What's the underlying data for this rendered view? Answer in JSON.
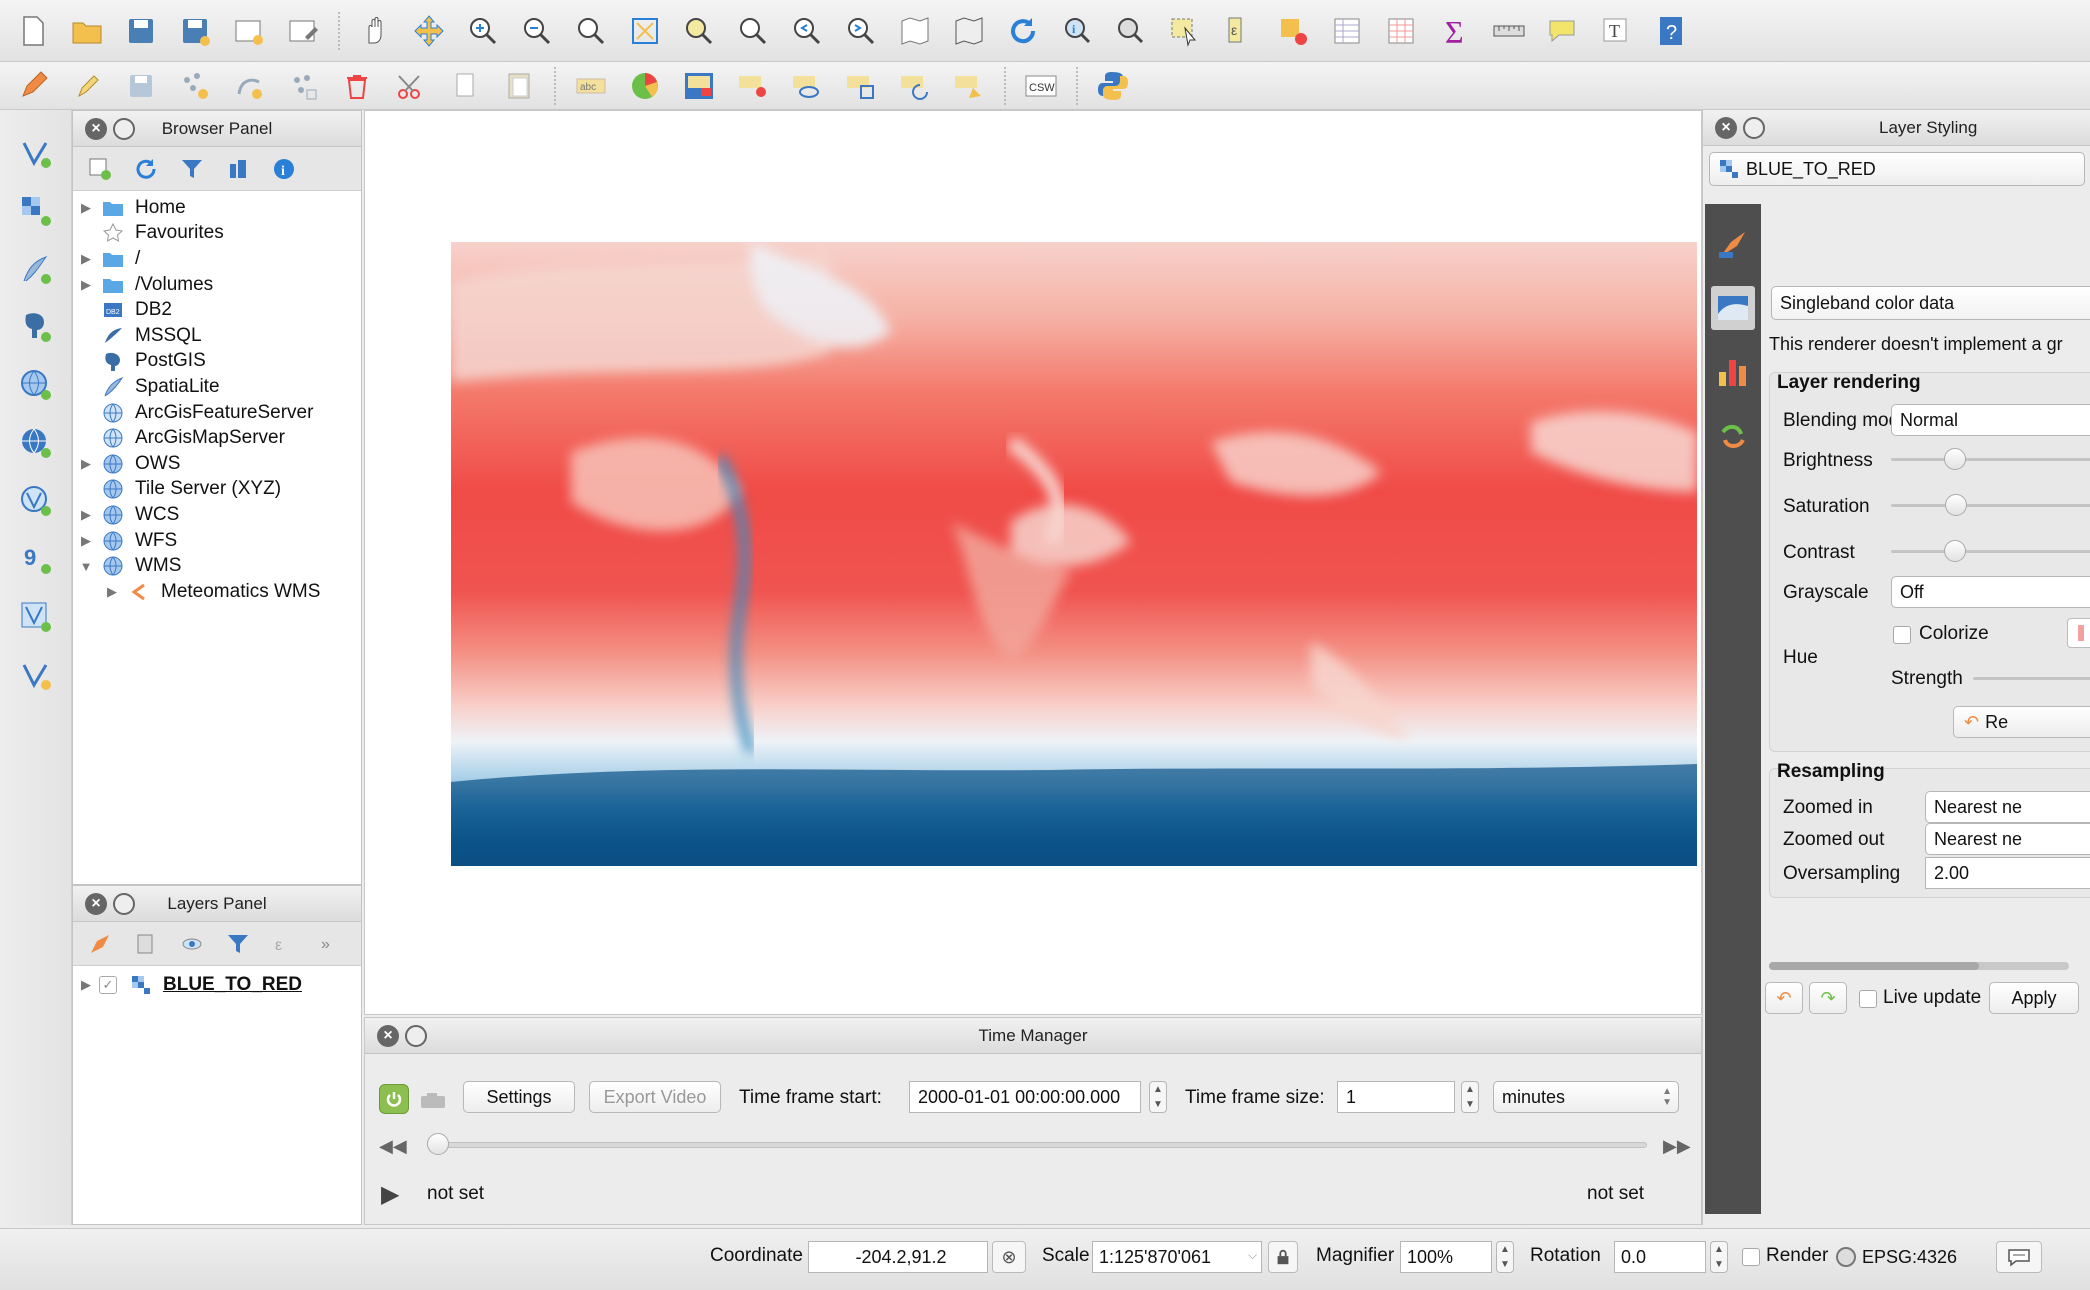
{
  "toolbar_top": {
    "icons": [
      "new-project-icon",
      "open-project-icon",
      "save-project-icon",
      "save-as-icon",
      "new-print-layout-icon",
      "layout-manager-icon",
      "pan-icon",
      "pan-to-selection-icon",
      "zoom-in-icon",
      "zoom-out-icon",
      "zoom-native-icon",
      "zoom-full-icon",
      "zoom-to-selection-icon",
      "zoom-to-layer-icon",
      "zoom-last-icon",
      "zoom-next-icon",
      "new-map-view-icon",
      "new-3d-map-icon",
      "refresh-icon",
      "identify-icon",
      "action-icon",
      "select-icon",
      "deselect-icon",
      "field-calculator-icon",
      "attribute-table-icon",
      "statistics-icon",
      "sum-icon",
      "measure-icon",
      "annotation-icon",
      "text-annotation-icon",
      "help-icon"
    ]
  },
  "toolbar_second": {
    "icons": [
      "edit-pencil-icon",
      "toggle-editing-icon",
      "save-edits-icon",
      "add-feature-icon",
      "node-tool-icon",
      "move-feature-icon",
      "delete-selected-icon",
      "cut-icon",
      "copy-icon",
      "paste-icon",
      "label-icon",
      "pie-diagram-icon",
      "label-highlight-icon",
      "pin-label-icon",
      "show-label-icon",
      "move-label-icon",
      "rotate-label-icon",
      "change-label-icon",
      "csw-icon",
      "python-icon"
    ],
    "csw_label": "CSW"
  },
  "left_toolbar": {
    "icons": [
      "add-vector-layer-icon",
      "add-raster-layer-icon",
      "add-spatialite-icon",
      "add-postgis-icon",
      "add-wms-icon",
      "add-wcs-icon",
      "add-wfs-icon",
      "add-delimited-text-icon",
      "add-virtual-layer-icon",
      "new-shapefile-icon"
    ]
  },
  "browser_panel": {
    "title": "Browser Panel",
    "items": [
      {
        "label": "Home",
        "icon": "folder-icon",
        "expandable": true
      },
      {
        "label": "Favourites",
        "icon": "star-icon",
        "expandable": false
      },
      {
        "label": "/",
        "icon": "folder-icon",
        "expandable": true
      },
      {
        "label": "/Volumes",
        "icon": "folder-icon",
        "expandable": true
      },
      {
        "label": "DB2",
        "icon": "db2-icon",
        "expandable": false
      },
      {
        "label": "MSSQL",
        "icon": "mssql-icon",
        "expandable": false
      },
      {
        "label": "PostGIS",
        "icon": "postgis-icon",
        "expandable": false
      },
      {
        "label": "SpatiaLite",
        "icon": "spatialite-icon",
        "expandable": false
      },
      {
        "label": "ArcGisFeatureServer",
        "icon": "arcgis-icon",
        "expandable": false
      },
      {
        "label": "ArcGisMapServer",
        "icon": "arcgis-icon",
        "expandable": false
      },
      {
        "label": "OWS",
        "icon": "globe-icon",
        "expandable": true
      },
      {
        "label": "Tile Server (XYZ)",
        "icon": "globe-icon",
        "expandable": false
      },
      {
        "label": "WCS",
        "icon": "globe-icon",
        "expandable": true
      },
      {
        "label": "WFS",
        "icon": "globe-icon",
        "expandable": true
      },
      {
        "label": "WMS",
        "icon": "globe-icon",
        "expandable": true,
        "expanded": true
      },
      {
        "label": "Meteomatics WMS",
        "icon": "connection-icon",
        "expandable": true,
        "child": true
      }
    ]
  },
  "layers_panel": {
    "title": "Layers Panel",
    "layer": {
      "name": "BLUE_TO_RED",
      "checked": true
    }
  },
  "time_manager": {
    "title": "Time Manager",
    "settings_label": "Settings",
    "export_label": "Export Video",
    "start_label": "Time frame start:",
    "start_value": "2000-01-01 00:00:00.000",
    "size_label": "Time frame size:",
    "size_value": "1",
    "unit_value": "minutes",
    "left_status": "not set",
    "right_status": "not set"
  },
  "layer_styling": {
    "title": "Layer Styling",
    "layer_select": "BLUE_TO_RED",
    "renderer": "Singleband color data",
    "renderer_note": "This renderer doesn't implement a gr",
    "layer_rendering_header": "Layer rendering",
    "blending_label": "Blending mode",
    "blending_value": "Normal",
    "brightness_label": "Brightness",
    "saturation_label": "Saturation",
    "contrast_label": "Contrast",
    "grayscale_label": "Grayscale",
    "grayscale_value": "Off",
    "hue_label": "Hue",
    "colorize_label": "Colorize",
    "strength_label": "Strength",
    "reset_label": "Re",
    "resampling_header": "Resampling",
    "zoomed_in_label": "Zoomed in",
    "zoomed_in_value": "Nearest ne",
    "zoomed_out_label": "Zoomed out",
    "zoomed_out_value": "Nearest ne",
    "oversampling_label": "Oversampling",
    "oversampling_value": "2.00",
    "live_update_label": "Live update",
    "apply_label": "Apply"
  },
  "statusbar": {
    "coordinate_label": "Coordinate",
    "coordinate_value": "-204.2,91.2",
    "scale_label": "Scale",
    "scale_value": "1:125'870'061",
    "magnifier_label": "Magnifier",
    "magnifier_value": "100%",
    "rotation_label": "Rotation",
    "rotation_value": "0.0",
    "render_label": "Render",
    "crs_value": "EPSG:4326"
  },
  "colors": {
    "accent_blue": "#2a7fd6",
    "temp_hot": "#f14b4b",
    "temp_cold": "#0d4f82"
  }
}
